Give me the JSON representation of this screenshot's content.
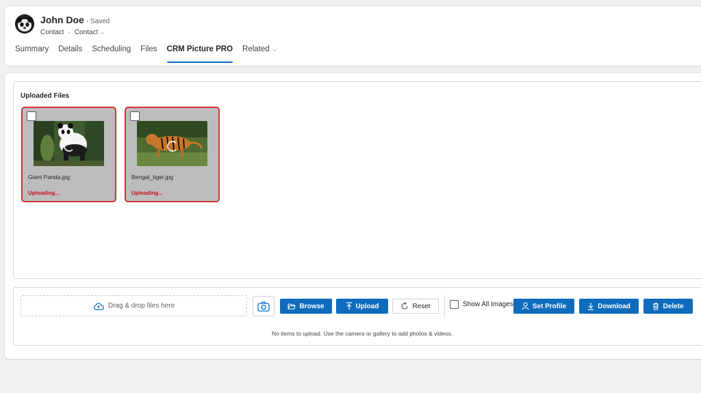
{
  "header": {
    "name": "John Doe",
    "saved": "- Saved",
    "entity": "Contact",
    "form": "Contact"
  },
  "tabs": [
    {
      "label": "Summary",
      "active": false
    },
    {
      "label": "Details",
      "active": false
    },
    {
      "label": "Scheduling",
      "active": false
    },
    {
      "label": "Files",
      "active": false
    },
    {
      "label": "CRM Picture PRO",
      "active": true
    },
    {
      "label": "Related",
      "active": false
    }
  ],
  "files": {
    "title": "Uploaded Files",
    "items": [
      {
        "name": "Giant Panda.jpg",
        "size": "-",
        "status": "Uploading..."
      },
      {
        "name": "Bengal_tiger.jpg",
        "size": "-",
        "status": "Uploading..."
      }
    ]
  },
  "toolbar": {
    "dropzone": "Drag & drop files here",
    "browse": "Browse",
    "upload": "Upload",
    "reset": "Reset",
    "show_all": "Show All Images",
    "set_profile": "Set Profile",
    "download": "Download",
    "delete": "Delete",
    "info": "No items to upload. Use the camera or gallery to add photos & videos."
  },
  "colors": {
    "accent": "#0f6cbd",
    "error": "#d13438"
  }
}
